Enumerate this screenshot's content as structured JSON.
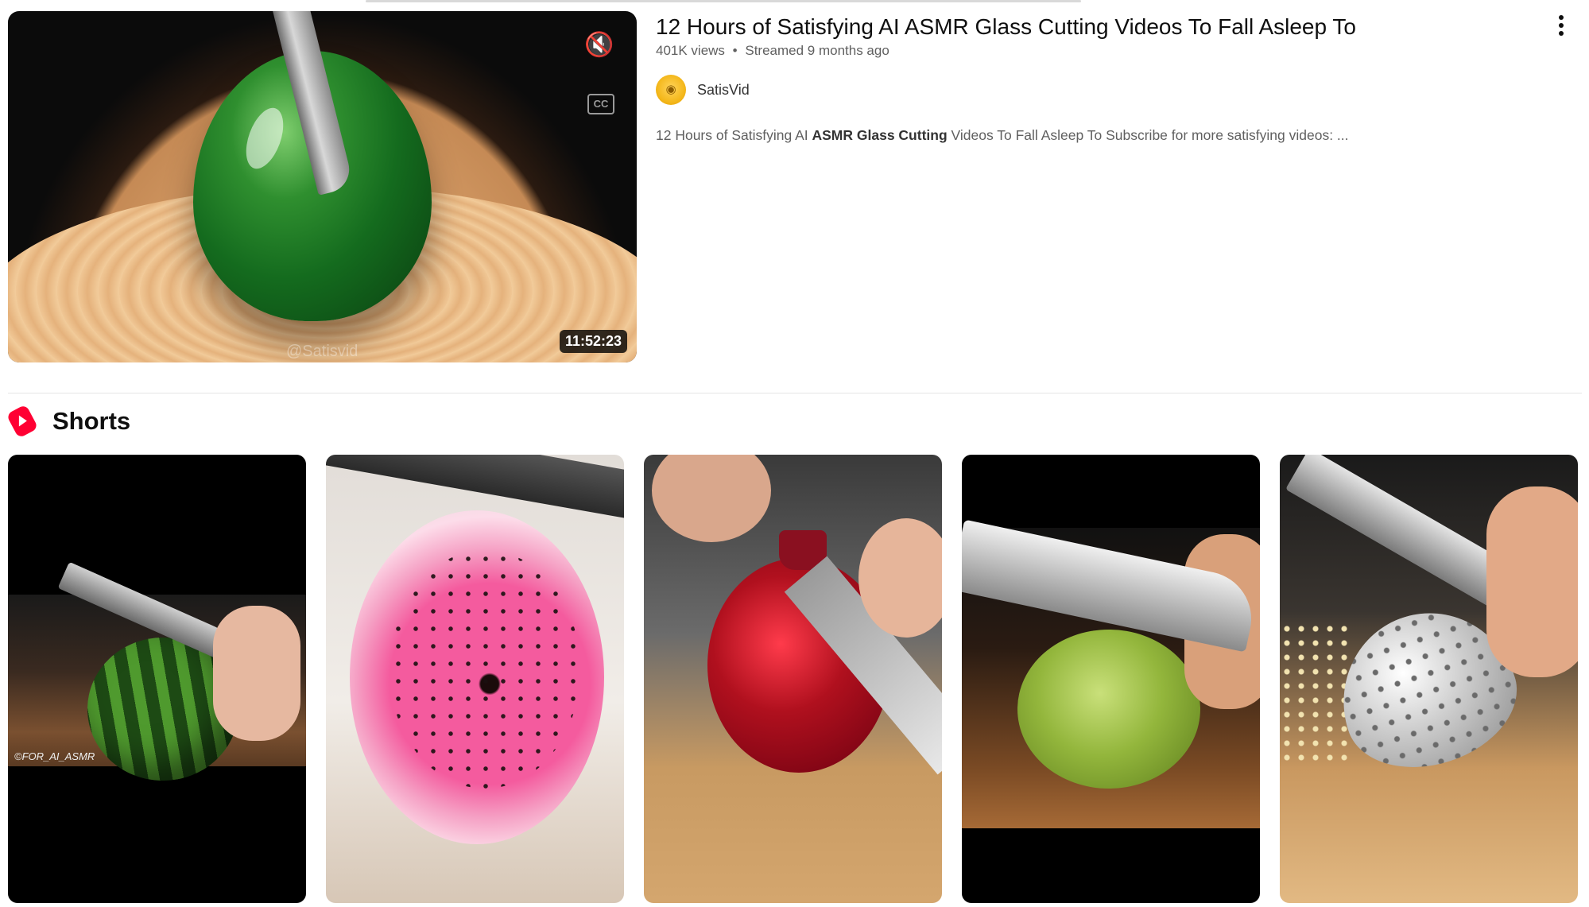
{
  "video": {
    "title": "12 Hours of Satisfying AI ASMR Glass Cutting Videos To Fall Asleep To",
    "views": "401K views",
    "separator": "•",
    "streamed": "Streamed 9 months ago",
    "duration": "11:52:23",
    "watermark": "@Satisvid",
    "channel": {
      "name": "SatisVid",
      "avatar_icon": "satisvid-avatar"
    },
    "description": {
      "part1": "12 Hours of Satisfying AI ",
      "bold": "ASMR Glass Cutting",
      "part2": " Videos To Fall Asleep To Subscribe for more satisfying videos: ..."
    },
    "controls": {
      "mute_icon": "speaker-muted-icon",
      "cc_label": "CC"
    }
  },
  "shorts": {
    "title": "Shorts",
    "icon": "youtube-shorts-icon",
    "brand_color": "#ff0033",
    "items": [
      {
        "subject": "watermelon",
        "watermark": "©FOR_AI_ASMR"
      },
      {
        "subject": "glass dragon fruit"
      },
      {
        "subject": "pomegranate"
      },
      {
        "subject": "green grape"
      },
      {
        "subject": "silver strawberry"
      }
    ]
  }
}
